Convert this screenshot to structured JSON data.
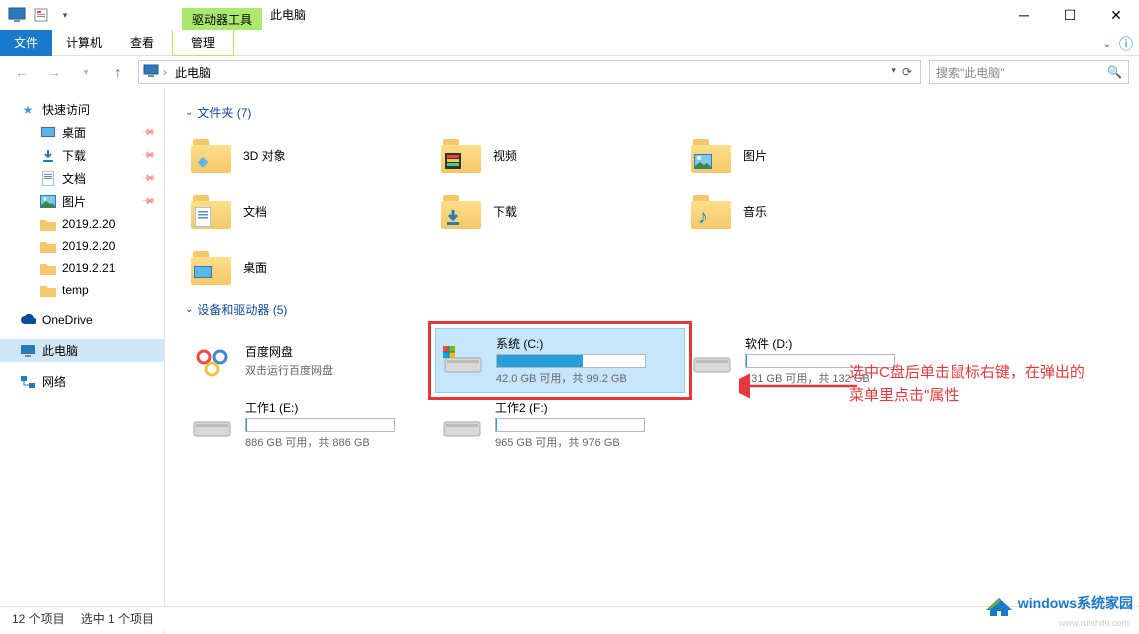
{
  "window": {
    "title": "此电脑",
    "context_tab": "驱动器工具",
    "tool_tab": "管理"
  },
  "ribbon": {
    "file": "文件",
    "computer": "计算机",
    "view": "查看"
  },
  "address": {
    "path": "此电脑",
    "search_placeholder": "搜索\"此电脑\""
  },
  "sidebar": {
    "quick_access": "快速访问",
    "desktop": "桌面",
    "downloads": "下载",
    "documents": "文档",
    "pictures": "图片",
    "folder1": "2019.2.20",
    "folder2": "2019.2.20",
    "folder3": "2019.2.21",
    "folder4": "temp",
    "onedrive": "OneDrive",
    "this_pc": "此电脑",
    "network": "网络"
  },
  "sections": {
    "folders": "文件夹 (7)",
    "devices": "设备和驱动器 (5)"
  },
  "folders": {
    "objects3d": "3D 对象",
    "videos": "视频",
    "pictures": "图片",
    "documents": "文档",
    "downloads": "下载",
    "music": "音乐",
    "desktop": "桌面"
  },
  "devices": [
    {
      "name": "百度网盘",
      "sub": "双击运行百度网盘",
      "type": "baidu"
    },
    {
      "name": "系统 (C:)",
      "sub": "42.0 GB 可用，共 99.2 GB",
      "type": "drive",
      "used_pct": 58,
      "highlighted": true
    },
    {
      "name": "软件 (D:)",
      "sub": "131 GB 可用，共 132 GB",
      "type": "drive",
      "used_pct": 1
    },
    {
      "name": "工作1 (E:)",
      "sub": "886 GB 可用，共 886 GB",
      "type": "drive",
      "used_pct": 0
    },
    {
      "name": "工作2 (F:)",
      "sub": "965 GB 可用，共 976 GB",
      "type": "drive",
      "used_pct": 1
    }
  ],
  "annotation": {
    "line1": "选中C盘后单击鼠标右键，在弹出的",
    "line2": "菜单里点击\"属性"
  },
  "statusbar": {
    "items": "12 个项目",
    "selected": "选中 1 个项目"
  },
  "watermark": {
    "text": "windows系统家园",
    "url": "www.ruishifu.com"
  }
}
